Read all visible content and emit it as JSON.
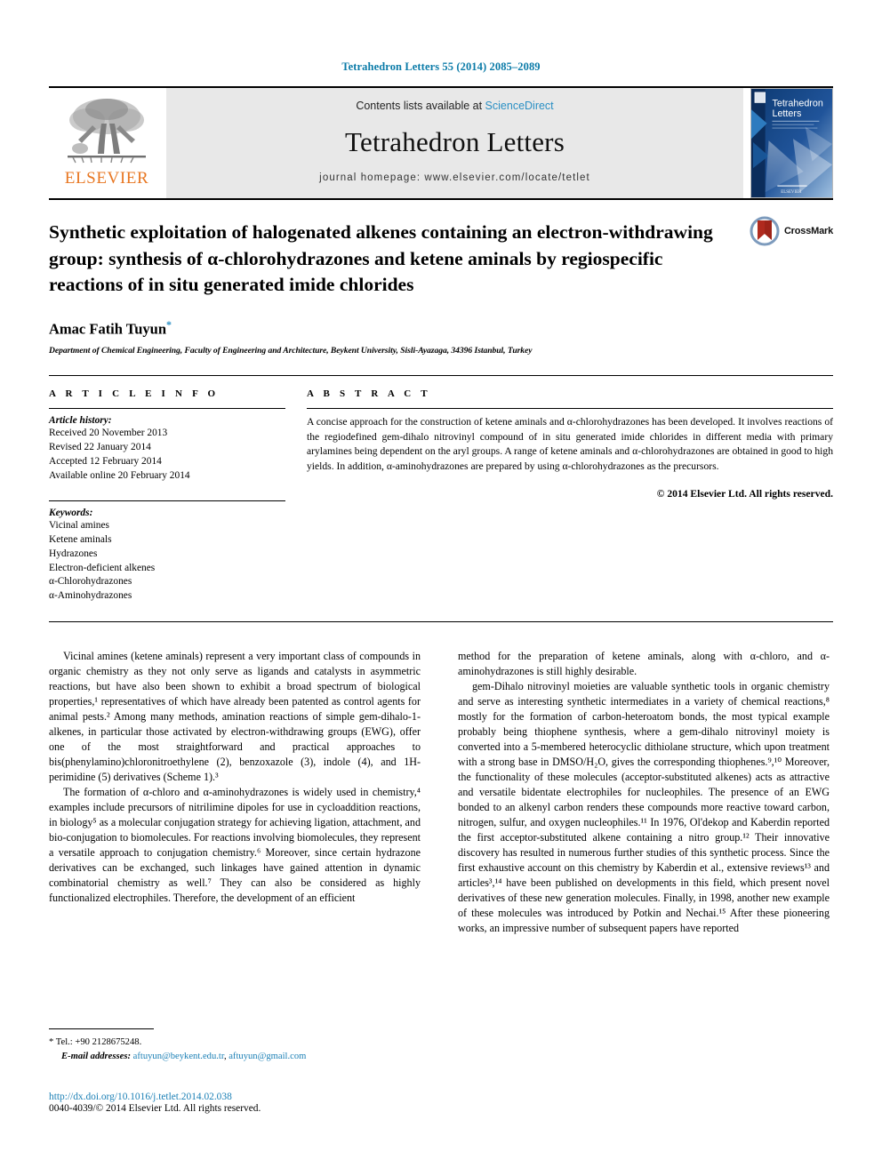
{
  "running_head": "Tetrahedron Letters 55 (2014) 2085–2089",
  "masthead": {
    "publisher_name": "ELSEVIER",
    "contents_prefix": "Contents lists available at ",
    "sciencedirect": "ScienceDirect",
    "journal_name": "Tetrahedron Letters",
    "homepage": "journal homepage: www.elsevier.com/locate/tetlet",
    "cover_title_line1": "Tetrahedron",
    "cover_title_line2": "Letters",
    "cover_footer": "ELSEVIER"
  },
  "title": "Synthetic exploitation of halogenated alkenes containing an electron-withdrawing group: synthesis of α-chlorohydrazones and ketene aminals by regiospecific reactions of in situ generated imide chlorides",
  "crossmark_label": "CrossMark",
  "author": "Amac Fatih Tuyun",
  "author_marker": "*",
  "affiliation": "Department of Chemical Engineering, Faculty of Engineering and Architecture, Beykent University, Sisli-Ayazaga, 34396 Istanbul, Turkey",
  "article_info": {
    "heading": "A R T I C L E   I N F O",
    "history_label": "Article history:",
    "history": [
      "Received 20 November 2013",
      "Revised 22 January 2014",
      "Accepted 12 February 2014",
      "Available online 20 February 2014"
    ],
    "keywords_label": "Keywords:",
    "keywords": [
      "Vicinal amines",
      "Ketene aminals",
      "Hydrazones",
      "Electron-deficient alkenes",
      "α-Chlorohydrazones",
      "α-Aminohydrazones"
    ]
  },
  "abstract": {
    "heading": "A B S T R A C T",
    "text": "A concise approach for the construction of ketene aminals and α-chlorohydrazones has been developed. It involves reactions of the regiodefined gem-dihalo nitrovinyl compound of in situ generated imide chlorides in different media with primary arylamines being dependent on the aryl groups. A range of ketene aminals and α-chlorohydrazones are obtained in good to high yields. In addition, α-aminohydrazones are prepared by using α-chlorohydrazones as the precursors.",
    "copyright": "© 2014 Elsevier Ltd. All rights reserved."
  },
  "body": {
    "left_paragraph_1": "Vicinal amines (ketene aminals) represent a very important class of compounds in organic chemistry as they not only serve as ligands and catalysts in asymmetric reactions, but have also been shown to exhibit a broad spectrum of biological properties,¹ representatives of which have already been patented as control agents for animal pests.² Among many methods, amination reactions of simple gem-dihalo-1-alkenes, in particular those activated by electron-withdrawing groups (EWG), offer one of the most straightforward and practical approaches to bis(phenylamino)chloronitroethylene (2), benzoxazole (3), indole (4), and 1H-perimidine (5) derivatives (Scheme 1).³",
    "left_paragraph_2": "The formation of α-chloro and α-aminohydrazones is widely used in chemistry,⁴ examples include precursors of nitrilimine dipoles for use in cycloaddition reactions, in biology⁵ as a molecular conjugation strategy for achieving ligation, attachment, and bio-conjugation to biomolecules. For reactions involving biomolecules, they represent a versatile approach to conjugation chemistry.⁶ Moreover, since certain hydrazone derivatives can be exchanged, such linkages have gained attention in dynamic combinatorial chemistry as well.⁷ They can also be considered as highly functionalized electrophiles. Therefore, the development of an efficient",
    "right_paragraph_1": "method for the preparation of ketene aminals, along with α-chloro, and α-aminohydrazones is still highly desirable.",
    "right_paragraph_2": "gem-Dihalo nitrovinyl moieties are valuable synthetic tools in organic chemistry and serve as interesting synthetic intermediates in a variety of chemical reactions,⁸ mostly for the formation of carbon-heteroatom bonds, the most typical example probably being thiophene synthesis, where a gem-dihalo nitrovinyl moiety is converted into a 5-membered heterocyclic dithiolane structure, which upon treatment with a strong base in DMSO/H₂O, gives the corresponding thiophenes.⁹,¹⁰ Moreover, the functionality of these molecules (acceptor-substituted alkenes) acts as attractive and versatile bidentate electrophiles for nucleophiles. The presence of an EWG bonded to an alkenyl carbon renders these compounds more reactive toward carbon, nitrogen, sulfur, and oxygen nucleophiles.¹¹ In 1976, Ol'dekop and Kaberdin reported the first acceptor-substituted alkene containing a nitro group.¹² Their innovative discovery has resulted in numerous further studies of this synthetic process. Since the first exhaustive account on this chemistry by Kaberdin et al., extensive reviews¹³ and articles³,¹⁴ have been published on developments in this field, which present novel derivatives of these new generation molecules. Finally, in 1998, another new example of these molecules was introduced by Potkin and Nechai.¹⁵ After these pioneering works, an impressive number of subsequent papers have reported"
  },
  "footnote": {
    "tel_marker": "*",
    "tel": "Tel.: +90 2128675248.",
    "email_label": "E-mail addresses:",
    "email_1": "aftuyun@beykent.edu.tr",
    "email_sep": ", ",
    "email_2": "aftuyun@gmail.com"
  },
  "footer": {
    "doi": "http://dx.doi.org/10.1016/j.tetlet.2014.02.038",
    "issn": "0040-4039/© 2014 Elsevier Ltd. All rights reserved."
  },
  "colors": {
    "link": "#1a7fb5",
    "elsevier_orange": "#E87722",
    "header_blue": "#0b7ba8",
    "band_gray": "#e8e8e8",
    "crossmark_red": "#B02A1E"
  }
}
